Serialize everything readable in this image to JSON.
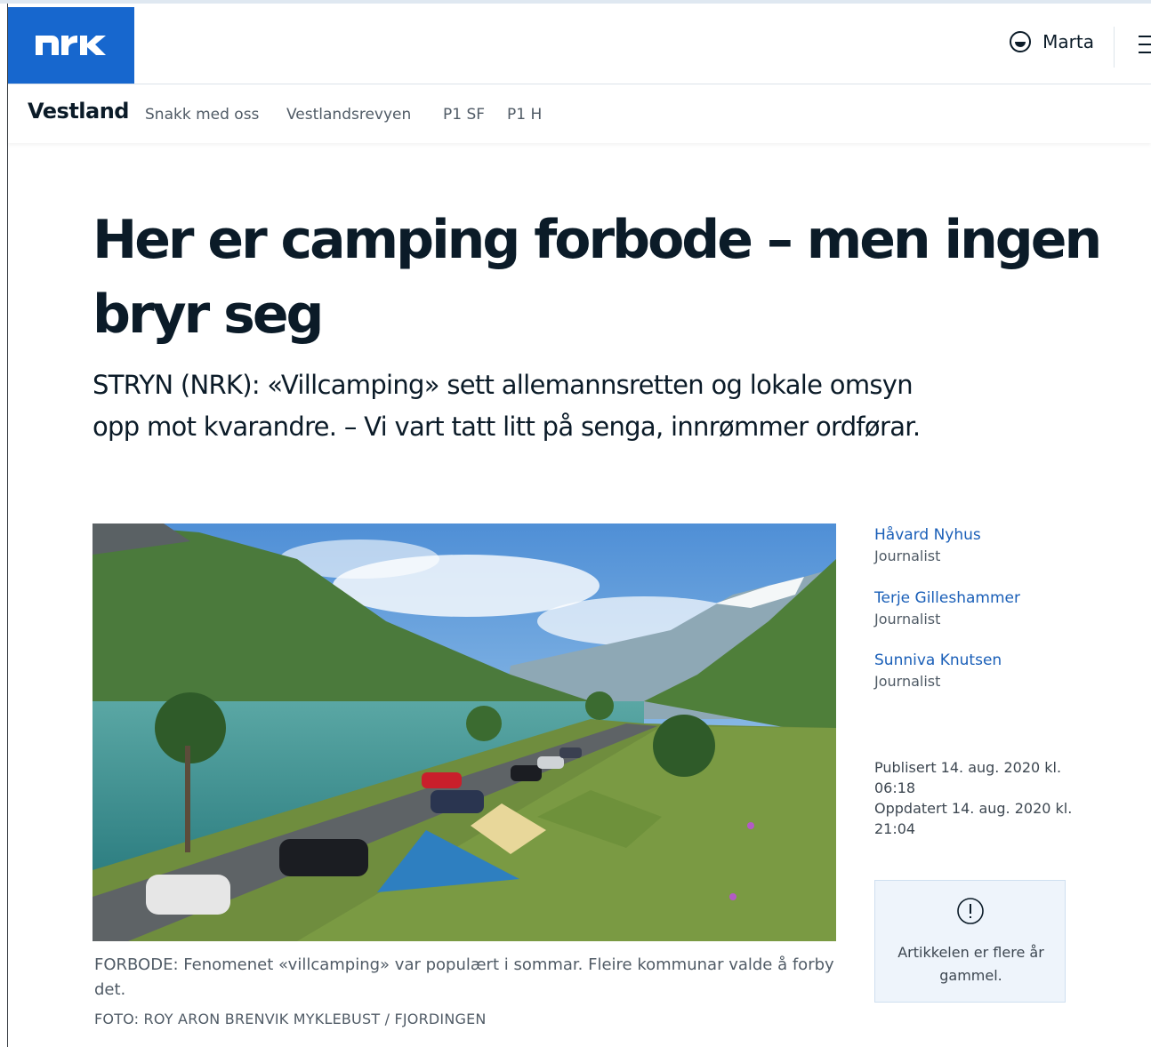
{
  "brand": {
    "logo_text": "NRK",
    "color": "#1767ce"
  },
  "header": {
    "user_name": "Marta",
    "user_icon": "user-face-icon",
    "menu_icon": "hamburger-icon"
  },
  "subnav": {
    "section": "Vestland",
    "links": [
      "Snakk med oss",
      "Vestlandsrevyen",
      "P1 SF",
      "P1 H"
    ]
  },
  "article": {
    "title": "Her er camping forbode – men ingen bryr seg",
    "lead": "STRYN (NRK): «Villcamping» sett allemannsretten og lokale omsyn opp mot kvarandre. – Vi vart tatt litt på senga, innrømmer ordførar.",
    "image_description_icon": "landscape-photo",
    "caption": "FORBODE: Fenomenet «villcamping» var populært i sommar. Fleire kommunar valde å forby det.",
    "credit": "FOTO: ROY ARON BRENVIK MYKLEBUST / FJORDINGEN"
  },
  "authors": [
    {
      "name": "Håvard Nyhus",
      "role": "Journalist"
    },
    {
      "name": "Terje Gilleshammer",
      "role": "Journalist"
    },
    {
      "name": "Sunniva Knutsen",
      "role": "Journalist"
    }
  ],
  "dates": {
    "published": "Publisert 14. aug. 2020 kl. 06:18",
    "updated": "Oppdatert 14. aug. 2020 kl. 21:04"
  },
  "notice": {
    "icon": "exclamation-circle-icon",
    "text": "Artikkelen er flere år gammel."
  }
}
